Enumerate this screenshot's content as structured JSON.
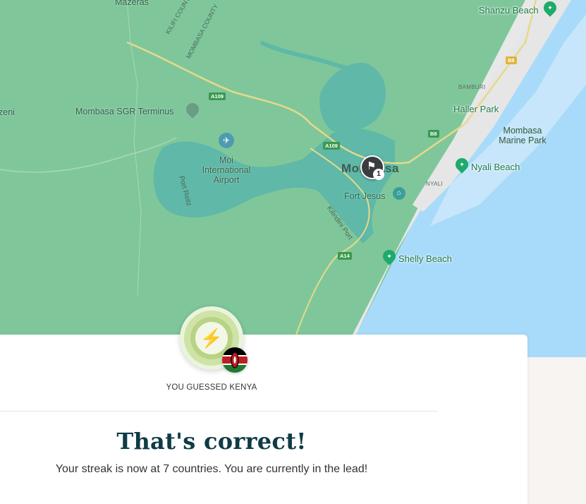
{
  "map": {
    "labels": {
      "mazeras": "Mazeras",
      "kilifi_county": "KILIFI COUNTY",
      "mombasa_county": "MOMBASA COUNTY",
      "zeni": "zeni",
      "sgr_terminus": "Mombasa SGR Terminus",
      "airport": "Moi\nInternational\nAirport",
      "port_reitz": "Port Reitz",
      "mombasa": "Mombasa",
      "fort_jesus": "Fort Jesus",
      "kilindini_port": "Kilindini Port",
      "shanzu_beach": "Shanzu Beach",
      "bamburi": "BAMBURI",
      "haller_park": "Haller Park",
      "marine_park": "Mombasa\nMarine Park",
      "nyali_beach": "Nyali Beach",
      "nyali": "NYALI",
      "shelly_beach": "Shelly Beach"
    },
    "road_shields": {
      "a109_top": "A109",
      "a109_mid": "A109",
      "b8_top": "B8",
      "b8_mid": "B8",
      "a14": "A14"
    },
    "guess_marker": {
      "icon": "flag-icon",
      "count": "1"
    },
    "colors": {
      "land": "#7fc79b",
      "water": "#a8dbf9",
      "inlet": "#5fb8a8",
      "beach": "#ececec"
    }
  },
  "result": {
    "badge_icon": "lightning-bolt-icon",
    "flag_icon": "kenya-flag-icon",
    "guess_label": "YOU GUESSED KENYA",
    "title": "That's correct!",
    "subtitle": "Your streak is now at 7 countries. You are currently in the lead!"
  }
}
